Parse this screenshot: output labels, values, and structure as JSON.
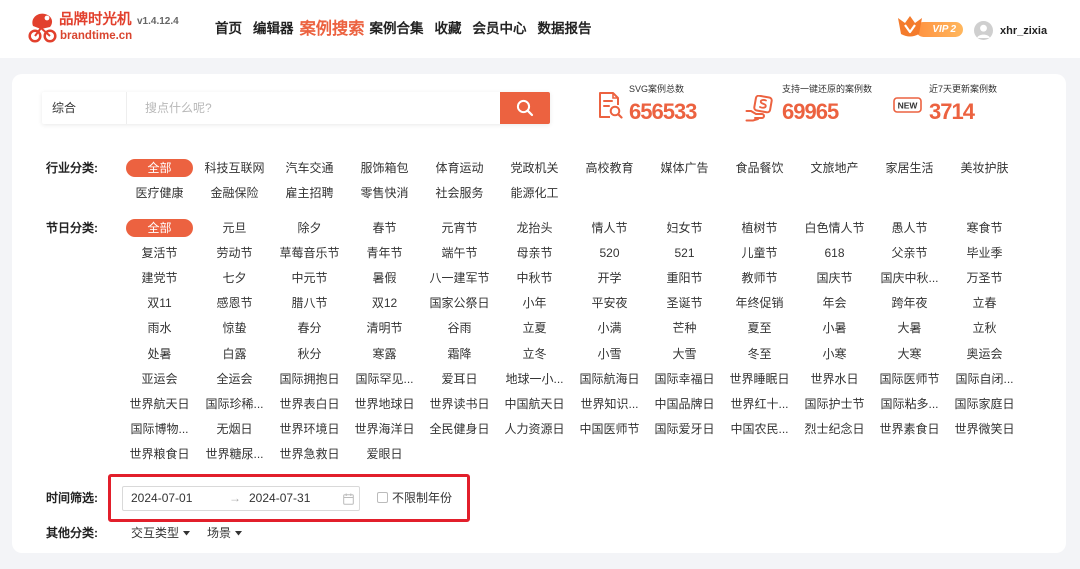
{
  "header": {
    "logo": {
      "name": "品牌时光机",
      "version": "v1.4.12.4",
      "domain": "brandtime.cn",
      "icon": "bicycle-logo-icon"
    },
    "nav": [
      {
        "label": "首页",
        "active": false
      },
      {
        "label": "编辑器",
        "active": false
      },
      {
        "label": "案例搜索",
        "active": true
      },
      {
        "label": "案例合集",
        "active": false
      },
      {
        "label": "收藏",
        "active": false
      },
      {
        "label": "会员中心",
        "active": false
      },
      {
        "label": "数据报告",
        "active": false
      }
    ],
    "vip": {
      "label": "VIP",
      "level": "2",
      "icon": "vip-crown-icon"
    },
    "user": {
      "name": "xhr_zixia",
      "avatar_icon": "user-icon"
    }
  },
  "search": {
    "type_value": "综合",
    "placeholder": "搜点什么呢?",
    "button_icon": "search-icon"
  },
  "stats": [
    {
      "label": "SVG案例总数",
      "value": "656533",
      "icon": "document-search-icon"
    },
    {
      "label": "支持一键还原的案例数",
      "value": "69965",
      "icon": "restore-hand-icon"
    },
    {
      "label": "近7天更新案例数",
      "value": "3714",
      "icon": "new-badge-icon",
      "badge": "NEW"
    }
  ],
  "filters": {
    "industry": {
      "label": "行业分类:",
      "selected_index": 0,
      "tags": [
        "全部",
        "科技互联网",
        "汽车交通",
        "服饰箱包",
        "体育运动",
        "党政机关",
        "高校教育",
        "媒体广告",
        "食品餐饮",
        "文旅地产",
        "家居生活",
        "美妆护肤",
        "医疗健康",
        "金融保险",
        "雇主招聘",
        "零售快消",
        "社会服务",
        "能源化工"
      ]
    },
    "holiday": {
      "label": "节日分类:",
      "selected_index": 0,
      "tags": [
        "全部",
        "元旦",
        "除夕",
        "春节",
        "元宵节",
        "龙抬头",
        "情人节",
        "妇女节",
        "植树节",
        "白色情人节",
        "愚人节",
        "寒食节",
        "复活节",
        "劳动节",
        "草莓音乐节",
        "青年节",
        "端午节",
        "母亲节",
        "520",
        "521",
        "儿童节",
        "618",
        "父亲节",
        "毕业季",
        "建党节",
        "七夕",
        "中元节",
        "暑假",
        "八一建军节",
        "中秋节",
        "开学",
        "重阳节",
        "教师节",
        "国庆节",
        "国庆中秋...",
        "万圣节",
        "双11",
        "感恩节",
        "腊八节",
        "双12",
        "国家公祭日",
        "小年",
        "平安夜",
        "圣诞节",
        "年终促销",
        "年会",
        "跨年夜",
        "立春",
        "雨水",
        "惊蛰",
        "春分",
        "清明节",
        "谷雨",
        "立夏",
        "小满",
        "芒种",
        "夏至",
        "小暑",
        "大暑",
        "立秋",
        "处暑",
        "白露",
        "秋分",
        "寒露",
        "霜降",
        "立冬",
        "小雪",
        "大雪",
        "冬至",
        "小寒",
        "大寒",
        "奥运会",
        "亚运会",
        "全运会",
        "国际拥抱日",
        "国际罕见...",
        "爱耳日",
        "地球一小...",
        "国际航海日",
        "国际幸福日",
        "世界睡眠日",
        "世界水日",
        "国际医师节",
        "国际自闭...",
        "世界航天日",
        "国际珍稀...",
        "世界表白日",
        "世界地球日",
        "世界读书日",
        "中国航天日",
        "世界知识...",
        "中国品牌日",
        "世界红十...",
        "国际护士节",
        "国际粘多...",
        "国际家庭日",
        "国际博物...",
        "无烟日",
        "世界环境日",
        "世界海洋日",
        "全民健身日",
        "人力资源日",
        "中国医师节",
        "国际爱牙日",
        "中国农民...",
        "烈士纪念日",
        "世界素食日",
        "世界微笑日",
        "世界粮食日",
        "世界糖尿...",
        "世界急救日",
        "爱眼日"
      ]
    },
    "time": {
      "label": "时间筛选:",
      "start_date": "2024-07-01",
      "separator": "→",
      "end_date": "2024-07-31",
      "calendar_icon": "calendar-icon",
      "unlimited_year_label": "不限制年份",
      "unlimited_year_checked": false
    },
    "other": {
      "label": "其他分类:",
      "dropdowns": [
        {
          "label": "交互类型",
          "icon": "caret-down-icon"
        },
        {
          "label": "场景",
          "icon": "caret-down-icon"
        }
      ]
    }
  },
  "colors": {
    "accent": "#ec6240",
    "highlight_border": "#e21f2b",
    "page_background": "#f3f4f7",
    "text": "#333333"
  }
}
